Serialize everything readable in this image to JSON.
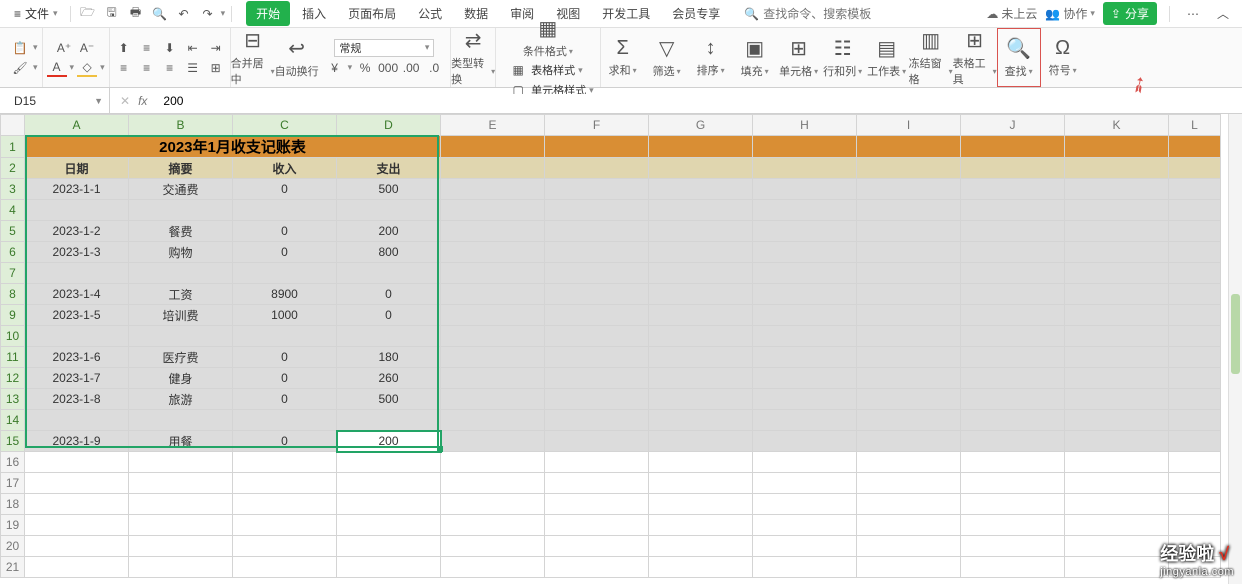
{
  "menubar": {
    "file": "文件",
    "search_placeholder": "查找命令、搜索模板",
    "cloud": "未上云",
    "collab": "协作",
    "share": "分享"
  },
  "tabs": [
    "开始",
    "插入",
    "页面布局",
    "公式",
    "数据",
    "审阅",
    "视图",
    "开发工具",
    "会员专享"
  ],
  "active_tab_index": 0,
  "ribbon": {
    "merge": "合并居中",
    "wrap": "自动换行",
    "number_format": "常规",
    "type_convert": "类型转换",
    "cond_format": "条件格式",
    "table_style": "表格样式",
    "cell_style": "单元格样式",
    "sum": "求和",
    "filter": "筛选",
    "sort": "排序",
    "fill": "填充",
    "cell": "单元格",
    "rowcol": "行和列",
    "sheet": "工作表",
    "freeze": "冻结窗格",
    "table_tools": "表格工具",
    "find": "查找",
    "symbol": "符号"
  },
  "formula_bar": {
    "cell_ref": "D15",
    "value": "200"
  },
  "columns": [
    "A",
    "B",
    "C",
    "D",
    "E",
    "F",
    "G",
    "H",
    "I",
    "J",
    "K",
    "L"
  ],
  "selected_cols": [
    0,
    1,
    2,
    3
  ],
  "row_count": 21,
  "selected_rows_from": 1,
  "selected_rows_to": 15,
  "active_cell": {
    "row": 15,
    "col": 3
  },
  "table": {
    "title": "2023年1月收支记账表",
    "headers": [
      "日期",
      "摘要",
      "收入",
      "支出"
    ],
    "rows": [
      [
        "2023-1-1",
        "交通费",
        "0",
        "500"
      ],
      [
        "",
        "",
        "",
        ""
      ],
      [
        "2023-1-2",
        "餐费",
        "0",
        "200"
      ],
      [
        "2023-1-3",
        "购物",
        "0",
        "800"
      ],
      [
        "",
        "",
        "",
        ""
      ],
      [
        "2023-1-4",
        "工资",
        "8900",
        "0"
      ],
      [
        "2023-1-5",
        "培训费",
        "1000",
        "0"
      ],
      [
        "",
        "",
        "",
        ""
      ],
      [
        "2023-1-6",
        "医疗费",
        "0",
        "180"
      ],
      [
        "2023-1-7",
        "健身",
        "0",
        "260"
      ],
      [
        "2023-1-8",
        "旅游",
        "0",
        "500"
      ],
      [
        "",
        "",
        "",
        ""
      ],
      [
        "2023-1-9",
        "用餐",
        "0",
        "200"
      ]
    ]
  },
  "watermark": {
    "line1a": "经验啦",
    "line1b": "√",
    "line2": "jingyanla.com"
  }
}
